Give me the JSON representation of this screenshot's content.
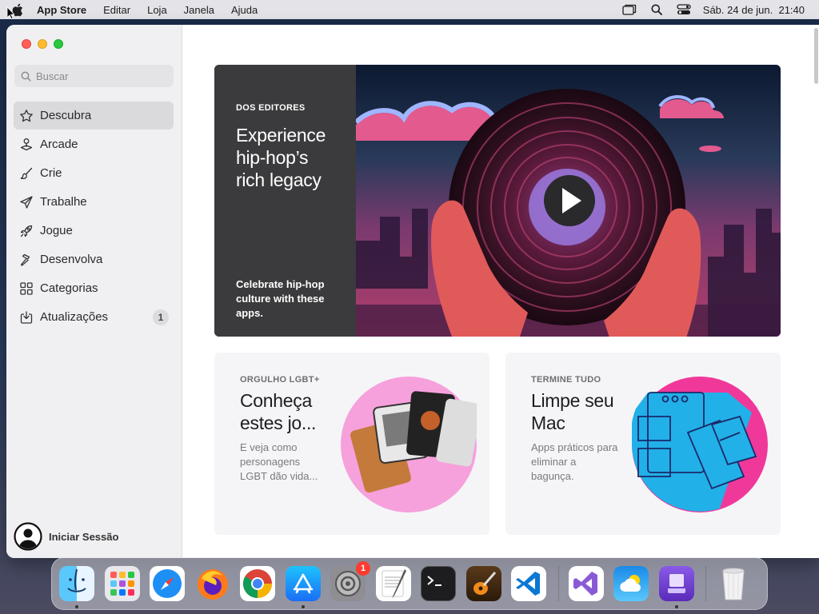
{
  "menubar": {
    "app_name": "App Store",
    "items": [
      "Editar",
      "Loja",
      "Janela",
      "Ajuda"
    ],
    "datetime": "Sáb. 24 de jun.  21:40",
    "icons": [
      "window-icon",
      "search-icon",
      "control-center-icon"
    ]
  },
  "sidebar": {
    "search_placeholder": "Buscar",
    "items": [
      {
        "label": "Descubra",
        "icon": "star-icon",
        "active": true
      },
      {
        "label": "Arcade",
        "icon": "joystick-icon"
      },
      {
        "label": "Crie",
        "icon": "brush-icon"
      },
      {
        "label": "Trabalhe",
        "icon": "paper-plane-icon"
      },
      {
        "label": "Jogue",
        "icon": "rocket-icon"
      },
      {
        "label": "Desenvolva",
        "icon": "hammer-icon"
      },
      {
        "label": "Categorias",
        "icon": "grid-icon"
      },
      {
        "label": "Atualizações",
        "icon": "download-icon",
        "badge": "1"
      }
    ],
    "signin_label": "Iniciar Sessão"
  },
  "hero": {
    "eyebrow": "DOS EDITORES",
    "title": "Experience hip-hop’s rich legacy",
    "description": "Celebrate hip-hop culture with these apps."
  },
  "cards": [
    {
      "eyebrow": "ORGULHO LGBT+",
      "title": "Conheça estes jo...",
      "description": "E veja como personagens LGBT dão vida..."
    },
    {
      "eyebrow": "TERMINE TUDO",
      "title": "Limpe seu Mac",
      "description": "Apps práticos para eliminar a bagunça."
    }
  ],
  "dock": {
    "apps": [
      "finder",
      "launchpad",
      "safari",
      "firefox",
      "chrome",
      "app-store",
      "system-settings",
      "textedit",
      "terminal",
      "garageband",
      "vscode",
      "visual-studio",
      "weather",
      "apple-configurator",
      "trash"
    ],
    "settings_badge": "1"
  },
  "colors": {
    "close": "#ff5f57",
    "minimize": "#febc2e",
    "maximize": "#28c840",
    "sidebar_bg": "#f0f0f2",
    "hero_panel": "#3b3b3d"
  }
}
